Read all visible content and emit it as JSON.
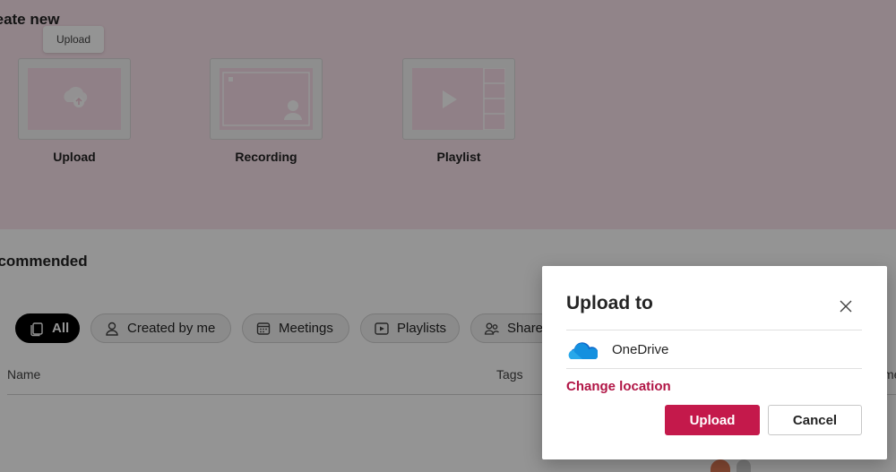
{
  "hero": {
    "title": "reate new",
    "tooltip": "Upload",
    "cards": [
      {
        "label": "Upload",
        "icon": "cloud-upload-icon"
      },
      {
        "label": "Recording",
        "icon": "screen-recording-icon"
      },
      {
        "label": "Playlist",
        "icon": "playlist-icon"
      }
    ]
  },
  "recommended": {
    "title": "ecommended",
    "filters": [
      {
        "label": "All",
        "icon": "all-stack-icon",
        "active": true
      },
      {
        "label": "Created by me",
        "icon": "person-icon",
        "active": false
      },
      {
        "label": "Meetings",
        "icon": "calendar-icon",
        "active": false
      },
      {
        "label": "Playlists",
        "icon": "play-list-icon",
        "active": false
      },
      {
        "label": "Share",
        "icon": "people-icon",
        "active": false
      }
    ],
    "columns": {
      "name": "Name",
      "tags": "Tags",
      "more": "me"
    }
  },
  "dialog": {
    "title": "Upload to",
    "location": {
      "label": "OneDrive",
      "icon": "onedrive-cloud-icon"
    },
    "change_location": "Change location",
    "primary_button": "Upload",
    "secondary_button": "Cancel",
    "close_icon": "close-icon"
  },
  "colors": {
    "accent": "#c4194b",
    "link": "#b11646",
    "hero_bg": "#fae3ec"
  }
}
